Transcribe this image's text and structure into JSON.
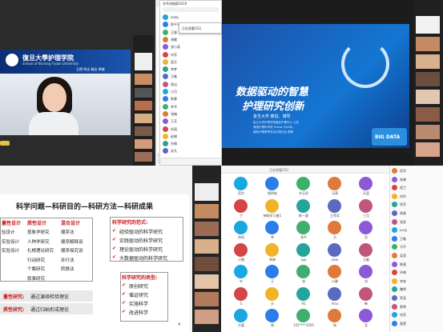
{
  "q1": {
    "school_cn": "復旦大學护理学院",
    "school_en": "School of Nursing Fudan University",
    "motto": "立德 明志 精业 奉献",
    "side_tiles": 9
  },
  "q2": {
    "chat_title": "学术讲座群2019",
    "chat_tab": "正在观看(52)",
    "members": [
      "andy",
      "陈平平",
      "王颖",
      "胡雁",
      "张小英",
      "刘芳",
      "蓝天",
      "李梦",
      "王敏",
      "周洁",
      "小月",
      "陈静",
      "李华",
      "张楠",
      "王芳",
      "徐丽",
      "赵琳",
      "孙倩",
      "吴凡"
    ],
    "slide_title_1": "数据驱动的智慧",
    "slide_title_2": "护理研究创新",
    "presenter": "复旦大学 教授、博导",
    "presenter_lines": [
      "复旦大学护理学院循证护理中心 主任",
      "美国护理科学院 Fellow (FAAN)",
      "国际护理荣誉学会中国分会 理事"
    ],
    "big_data": "BIG DATA"
  },
  "q3": {
    "title": "科学问题—科研目的—科研方法—科研成果",
    "col_headers": [
      "量性设计",
      "质性设计",
      "混合设计"
    ],
    "col1": [
      "验设计",
      "实验设计",
      "实验设计"
    ],
    "col2": [
      "现象学研究",
      "人种学研究",
      "扎根理论研究",
      "行动研究",
      "个案研究",
      "叙事研究"
    ],
    "col3": [
      "顺序法",
      "顺序解释设",
      "顺序探究设",
      "并行法",
      "转换法"
    ],
    "rows": [
      {
        "label": "量性研究:",
        "text": "通过演绎检验理论"
      },
      {
        "label": "质性研究:",
        "text": "通过归纳形成理论"
      }
    ],
    "paradigm_title": "科学研究的范式:",
    "paradigm_items": [
      "经验驱动的科学研究",
      "实践驱动的科学研究",
      "理论驱动的科学研究",
      "大数据驱动的科学研究"
    ],
    "type_title": "科学研究的类型:",
    "type_items": [
      "原创研究",
      "循证研究",
      "实施科学",
      "改进科学"
    ],
    "page_number": "4"
  },
  "q4": {
    "header_label": "正在观看(52)",
    "grid": [
      [
        "范尔",
        "程树枝",
        "许玉珍",
        "汪燕",
        "天涯"
      ],
      [
        "丁",
        "神秘学习者1",
        "陈一夏",
        "王萍芳",
        "三月"
      ],
      [
        "徐凤",
        "李",
        "张平",
        "方",
        "岳"
      ],
      [
        "小猪",
        "李婷",
        "zyp",
        "xiao",
        "王敏"
      ],
      [
        "许",
        "王",
        "张",
        "小静",
        "刘"
      ],
      [
        "5",
        "方",
        "91",
        "Aria",
        "韩"
      ],
      [
        "方斐",
        "周",
        "151****3355",
        "钱",
        "金"
      ]
    ],
    "side": [
      "吴华",
      "张晓",
      "程兰",
      "刘玲",
      "徐芬",
      "周青",
      "张亮",
      "Lucy",
      "王敏",
      "马平",
      "吴双",
      "陈燕",
      "孙琳",
      "李安",
      "魏明",
      "罗英",
      "蔡琴",
      "何芳",
      "袁茜"
    ]
  },
  "colors": {
    "dark": "#2a2a2a",
    "blue": "#1553a8",
    "red": "#c91a1a",
    "teal": "#1aa7e0"
  }
}
